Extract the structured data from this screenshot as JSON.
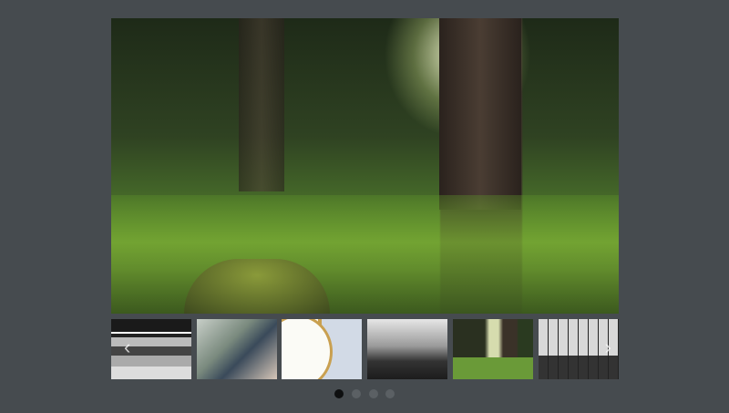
{
  "slider": {
    "main_image": {
      "alt": "forest-scene",
      "active_index": 4
    },
    "thumbnails": [
      {
        "subject": "motion-blurred-train"
      },
      {
        "subject": "crowd-on-escalators"
      },
      {
        "subject": "alarm-clock"
      },
      {
        "subject": "foggy-lake-bw"
      },
      {
        "subject": "forest-scene"
      },
      {
        "subject": "railway-lines-bw"
      }
    ],
    "prev_icon": "‹",
    "next_icon": "›",
    "pagination": {
      "pages": 4,
      "active": 1
    }
  },
  "colors": {
    "background": "#464b4f",
    "dot_active": "#0e0f10",
    "dot_inactive": "#5b6064"
  }
}
